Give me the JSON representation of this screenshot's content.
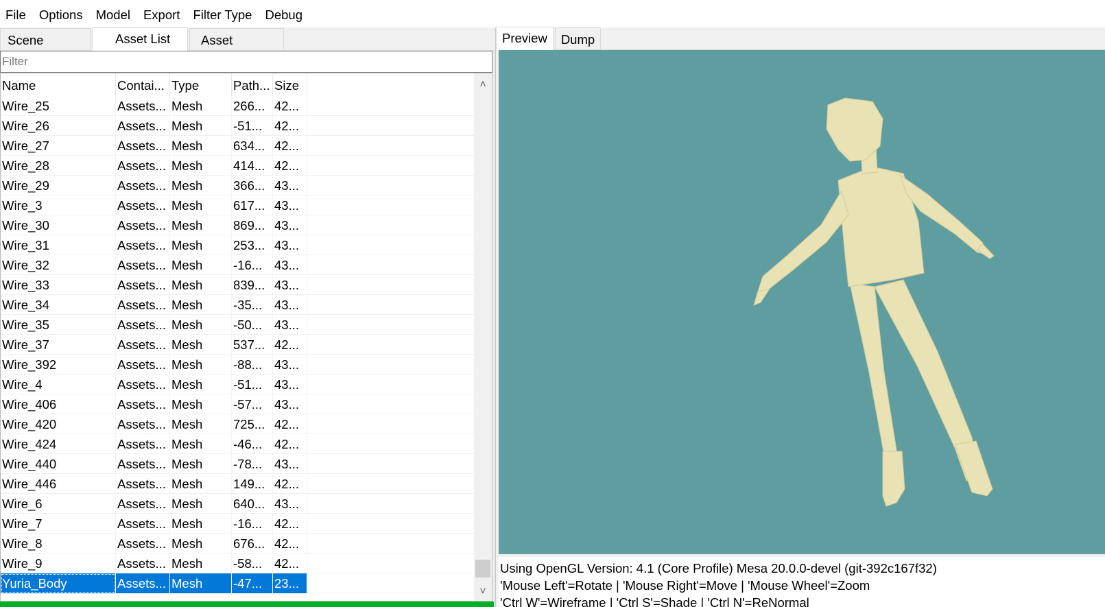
{
  "menu": [
    "File",
    "Options",
    "Model",
    "Export",
    "Filter Type",
    "Debug"
  ],
  "left_tabs": [
    {
      "label": "Scene Hierarchy",
      "active": false
    },
    {
      "label": "Asset List",
      "active": true
    },
    {
      "label": "Asset Classes",
      "active": false
    }
  ],
  "filter": {
    "placeholder": "Filter"
  },
  "table": {
    "columns": [
      "Name",
      "Contai...",
      "Type",
      "Path...",
      "Size"
    ],
    "rows": [
      [
        "Wire_25",
        "Assets...",
        "Mesh",
        "266...",
        "42..."
      ],
      [
        "Wire_26",
        "Assets...",
        "Mesh",
        "-51...",
        "42..."
      ],
      [
        "Wire_27",
        "Assets...",
        "Mesh",
        "634...",
        "42..."
      ],
      [
        "Wire_28",
        "Assets...",
        "Mesh",
        "414...",
        "42..."
      ],
      [
        "Wire_29",
        "Assets...",
        "Mesh",
        "366...",
        "43..."
      ],
      [
        "Wire_3",
        "Assets...",
        "Mesh",
        "617...",
        "43..."
      ],
      [
        "Wire_30",
        "Assets...",
        "Mesh",
        "869...",
        "43..."
      ],
      [
        "Wire_31",
        "Assets...",
        "Mesh",
        "253...",
        "43..."
      ],
      [
        "Wire_32",
        "Assets...",
        "Mesh",
        "-16...",
        "43..."
      ],
      [
        "Wire_33",
        "Assets...",
        "Mesh",
        "839...",
        "43..."
      ],
      [
        "Wire_34",
        "Assets...",
        "Mesh",
        "-35...",
        "43..."
      ],
      [
        "Wire_35",
        "Assets...",
        "Mesh",
        "-50...",
        "43..."
      ],
      [
        "Wire_37",
        "Assets...",
        "Mesh",
        "537...",
        "42..."
      ],
      [
        "Wire_392",
        "Assets...",
        "Mesh",
        "-88...",
        "43..."
      ],
      [
        "Wire_4",
        "Assets...",
        "Mesh",
        "-51...",
        "43..."
      ],
      [
        "Wire_406",
        "Assets...",
        "Mesh",
        "-57...",
        "43..."
      ],
      [
        "Wire_420",
        "Assets...",
        "Mesh",
        "725...",
        "42..."
      ],
      [
        "Wire_424",
        "Assets...",
        "Mesh",
        "-46...",
        "42..."
      ],
      [
        "Wire_440",
        "Assets...",
        "Mesh",
        "-78...",
        "43..."
      ],
      [
        "Wire_446",
        "Assets...",
        "Mesh",
        "149...",
        "42..."
      ],
      [
        "Wire_6",
        "Assets...",
        "Mesh",
        "640...",
        "43..."
      ],
      [
        "Wire_7",
        "Assets...",
        "Mesh",
        "-16...",
        "42..."
      ],
      [
        "Wire_8",
        "Assets...",
        "Mesh",
        "676...",
        "42..."
      ],
      [
        "Wire_9",
        "Assets...",
        "Mesh",
        "-58...",
        "42..."
      ],
      [
        "Yuria_Body",
        "Assets...",
        "Mesh",
        "-47...",
        "23..."
      ]
    ],
    "selected_index": 24
  },
  "progress": {
    "fraction": 1.0,
    "color": "#06b025"
  },
  "right_tabs": [
    {
      "label": "Preview",
      "active": true
    },
    {
      "label": "Dump",
      "active": false
    }
  ],
  "viewport": {
    "background": "#5f9ea0",
    "model_color": "#e8e2b4"
  },
  "status_lines": [
    "Using OpenGL Version: 4.1 (Core Profile) Mesa 20.0.0-devel (git-392c167f32)",
    "'Mouse Left'=Rotate | 'Mouse Right'=Move | 'Mouse Wheel'=Zoom",
    "'Ctrl W'=Wireframe | 'Ctrl S'=Shade | 'Ctrl N'=ReNormal"
  ],
  "icons": {
    "scroll_up": "chevron-up-icon",
    "scroll_down": "chevron-down-icon"
  }
}
